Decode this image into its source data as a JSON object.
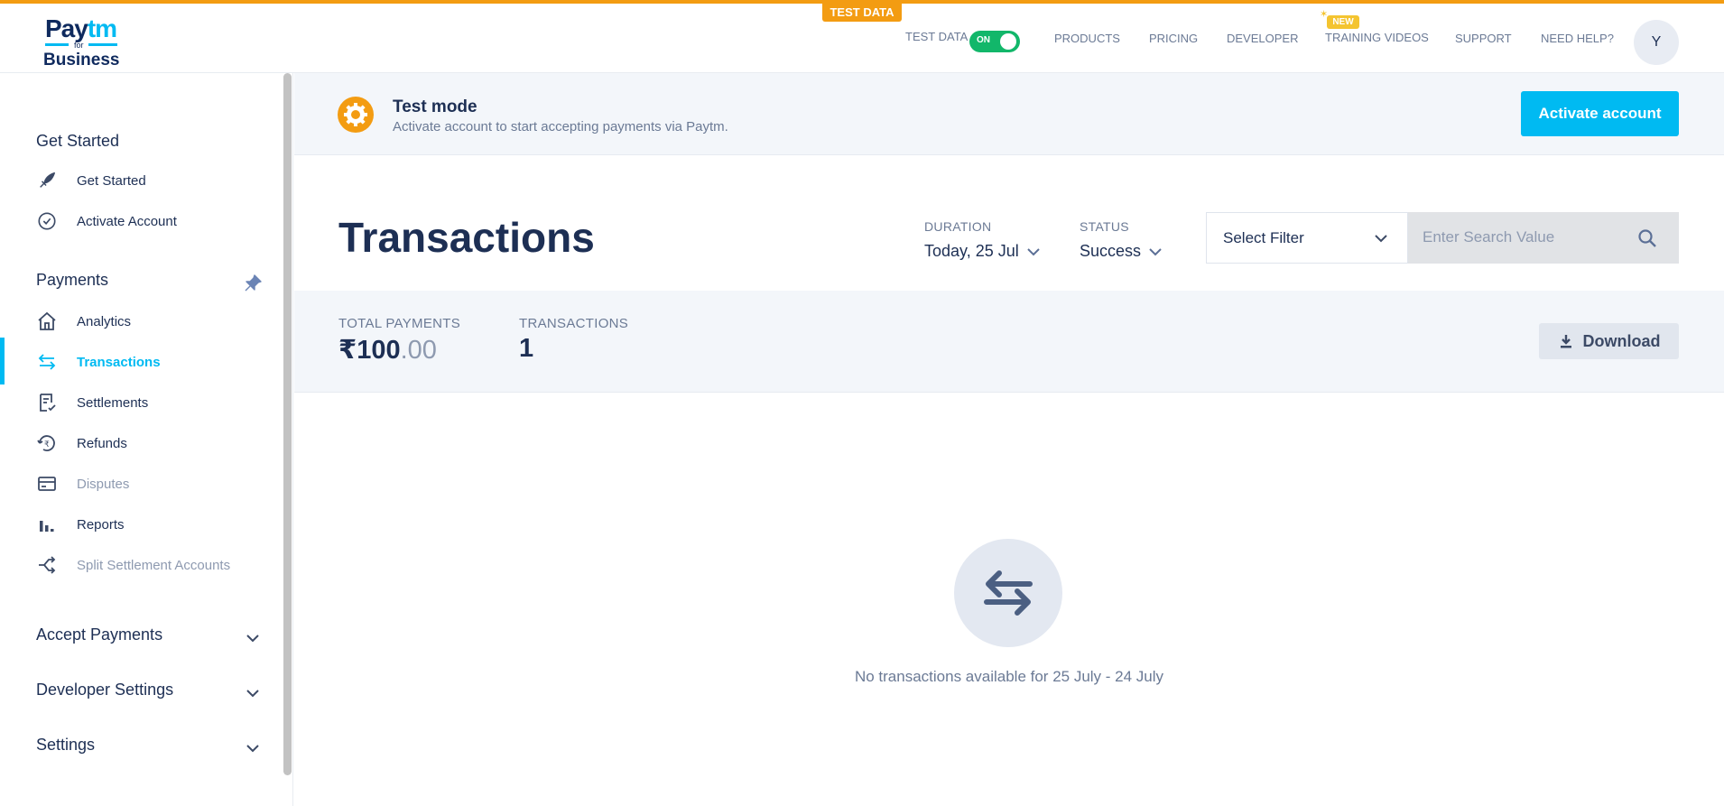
{
  "header": {
    "logo": {
      "pay": "Pay",
      "tm": "tm",
      "for": "for",
      "business": "Business"
    },
    "test_badge": "TEST DATA",
    "test_data_label": "TEST DATA",
    "toggle_label": "ON",
    "nav": [
      "PRODUCTS",
      "PRICING",
      "DEVELOPER",
      "TRAINING VIDEOS",
      "SUPPORT",
      "NEED HELP?"
    ],
    "new_badge": "NEW",
    "avatar_initial": "Y"
  },
  "sidebar": {
    "sections": {
      "get_started": "Get Started",
      "payments": "Payments",
      "accept_payments": "Accept Payments",
      "developer_settings": "Developer Settings",
      "settings": "Settings"
    },
    "items": [
      {
        "label": "Get Started",
        "icon": "rocket-icon"
      },
      {
        "label": "Activate Account",
        "icon": "check-circle-icon"
      },
      {
        "label": "Analytics",
        "icon": "home-icon"
      },
      {
        "label": "Transactions",
        "icon": "transfer-icon",
        "active": true
      },
      {
        "label": "Settlements",
        "icon": "settlement-icon"
      },
      {
        "label": "Refunds",
        "icon": "refund-icon"
      },
      {
        "label": "Disputes",
        "icon": "card-icon",
        "disabled": true
      },
      {
        "label": "Reports",
        "icon": "bar-chart-icon"
      },
      {
        "label": "Split Settlement Accounts",
        "icon": "split-icon",
        "disabled": true
      }
    ]
  },
  "banner": {
    "title": "Test mode",
    "subtitle": "Activate account to start accepting payments via Paytm.",
    "button": "Activate account",
    "accent": "#f39c12"
  },
  "main": {
    "title": "Transactions",
    "duration_label": "DURATION",
    "duration_value": "Today, 25 Jul",
    "status_label": "STATUS",
    "status_value": "Success",
    "filter_select": "Select Filter",
    "search_placeholder": "Enter Search Value",
    "summary": {
      "total_label": "TOTAL PAYMENTS",
      "total_currency": "₹",
      "total_whole": "100",
      "total_decimal": ".00",
      "count_label": "TRANSACTIONS",
      "count_value": "1"
    },
    "download_button": "Download",
    "empty_message": "No transactions available for 25 July - 24 July"
  },
  "colors": {
    "brand": "#00baf2",
    "navy": "#1d2f54",
    "toggle_on": "#12b76a",
    "warning": "#f39c12"
  }
}
